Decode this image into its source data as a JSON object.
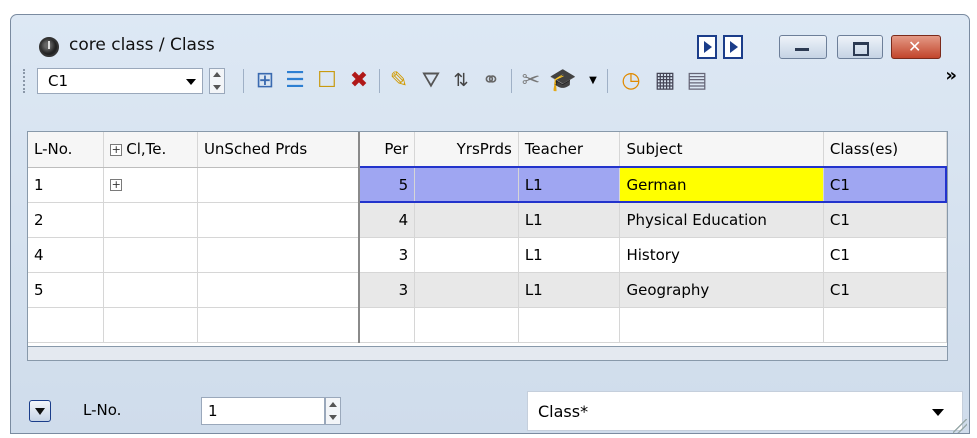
{
  "window": {
    "title": "core class / Class",
    "controls": [
      "minimize-icon",
      "maximize-icon",
      "close-icon"
    ],
    "nav_buttons": [
      "play-icon",
      "next-icon"
    ]
  },
  "toolbar": {
    "class_value": "C1",
    "icons": [
      "grid-move-icon",
      "list-icon",
      "new-item-icon",
      "delete-icon",
      "edit-pencil-icon",
      "filter-icon",
      "sort-icon",
      "link-icon",
      "tools-icon",
      "teacher-cap-icon",
      "clock-icon",
      "calendar-icon",
      "matrix-icon"
    ],
    "more": "»"
  },
  "grid": {
    "headers": [
      "L-No.",
      "Cl,Te.",
      "UnSched Prds",
      "Per",
      "YrsPrds",
      "Teacher",
      "Subject",
      "Class(es)"
    ],
    "rows": [
      {
        "lno": "1",
        "clte": "",
        "unsched": "",
        "per": "5",
        "yrsprds": "",
        "teacher": "L1",
        "subject": "German",
        "classes": "C1",
        "selected": true
      },
      {
        "lno": "2",
        "clte": "",
        "unsched": "",
        "per": "4",
        "yrsprds": "",
        "teacher": "L1",
        "subject": "Physical Education",
        "classes": "C1"
      },
      {
        "lno": "4",
        "clte": "",
        "unsched": "",
        "per": "3",
        "yrsprds": "",
        "teacher": "L1",
        "subject": "History",
        "classes": "C1"
      },
      {
        "lno": "5",
        "clte": "",
        "unsched": "",
        "per": "3",
        "yrsprds": "",
        "teacher": "L1",
        "subject": "Geography",
        "classes": "C1"
      }
    ],
    "highlight_color": "#ffff00",
    "selection_color": "#9fa6f2"
  },
  "bottom": {
    "lno_label": "L-No.",
    "lno_value": "1",
    "view_value": "Class*"
  }
}
